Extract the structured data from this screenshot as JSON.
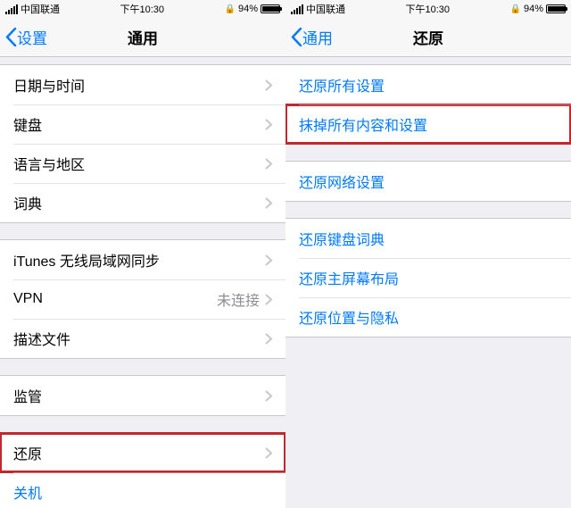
{
  "status": {
    "carrier": "中国联通",
    "time": "下午10:30",
    "battery_pct": "94%"
  },
  "left": {
    "back_label": "设置",
    "title": "通用",
    "g1": {
      "datetime": "日期与时间",
      "keyboard": "键盘",
      "lang": "语言与地区",
      "dict": "词典"
    },
    "g2": {
      "itunes": "iTunes 无线局域网同步",
      "vpn": "VPN",
      "vpn_value": "未连接",
      "profile": "描述文件"
    },
    "g3": {
      "regulatory": "监管"
    },
    "g4": {
      "reset": "还原",
      "shutdown": "关机"
    }
  },
  "right": {
    "back_label": "通用",
    "title": "还原",
    "g1": {
      "reset_all": "还原所有设置",
      "erase_all": "抹掉所有内容和设置"
    },
    "g2": {
      "reset_network": "还原网络设置"
    },
    "g3": {
      "reset_keyboard": "还原键盘词典",
      "reset_home": "还原主屏幕布局",
      "reset_location": "还原位置与隐私"
    }
  }
}
